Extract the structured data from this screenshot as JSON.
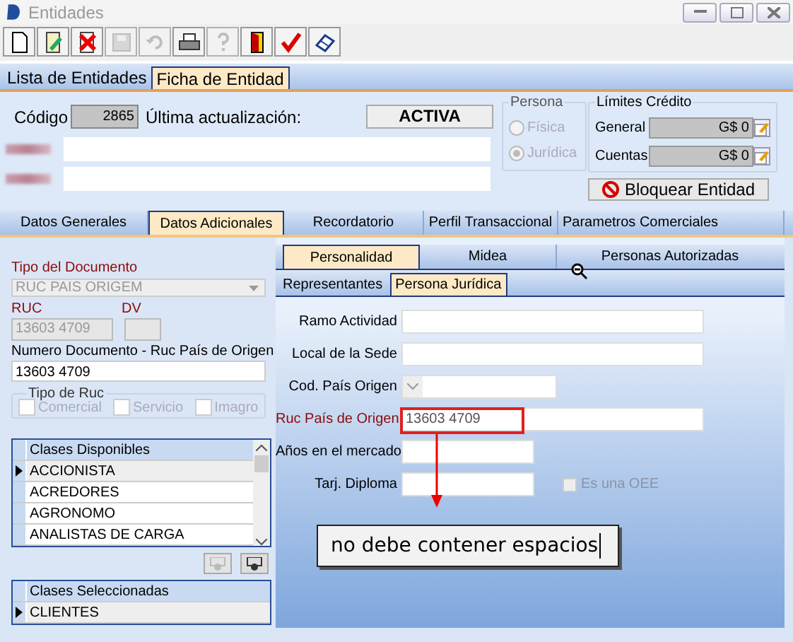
{
  "window": {
    "title": "Entidades"
  },
  "toolbar": [
    {
      "kind": "new",
      "disabled": false
    },
    {
      "kind": "edit",
      "disabled": false
    },
    {
      "kind": "delete",
      "disabled": false
    },
    {
      "kind": "save",
      "disabled": true
    },
    {
      "kind": "undo",
      "disabled": true
    },
    {
      "kind": "print",
      "disabled": false
    },
    {
      "kind": "help",
      "disabled": true
    },
    {
      "kind": "exit",
      "disabled": false
    },
    {
      "kind": "confirm",
      "disabled": false
    },
    {
      "kind": "eraser",
      "disabled": false
    }
  ],
  "main_tabs": [
    {
      "label": "Lista de Entidades",
      "selected": false
    },
    {
      "label": "Ficha de Entidad",
      "selected": true
    }
  ],
  "header": {
    "code_label": "Código",
    "code": "2865",
    "updated_label": "Última actualización:",
    "status": "ACTIVA",
    "persona": {
      "title": "Persona",
      "options": [
        {
          "label": "Física",
          "selected": false
        },
        {
          "label": "Jurídica",
          "selected": true
        }
      ]
    },
    "credit": {
      "title": "Límites Crédito",
      "rows": [
        {
          "label": "General",
          "value": "G$ 0"
        },
        {
          "label": "Cuentas",
          "value": "G$ 0"
        }
      ]
    },
    "block_button": "Bloquear Entidad"
  },
  "section_tabs": [
    {
      "label": "Datos Generales",
      "selected": false
    },
    {
      "label": "Datos Adicionales",
      "selected": true
    },
    {
      "label": "Recordatorio",
      "selected": false
    },
    {
      "label": "Perfil Transaccional",
      "selected": false
    },
    {
      "label": "Parametros Comerciales",
      "selected": false
    }
  ],
  "left": {
    "doc_type_label": "Tipo del Documento",
    "doc_type": "RUC PAIS ORIGEM",
    "ruc_label": "RUC",
    "ruc": "13603 4709",
    "dv_label": "DV",
    "number_label": "Numero Documento - Ruc País de Origen",
    "number": "13603 4709",
    "ruc_type": {
      "title": "Tipo de Ruc",
      "options": [
        {
          "label": "Comercial",
          "checked": false
        },
        {
          "label": "Servicio",
          "checked": false
        },
        {
          "label": "Imagro",
          "checked": false
        }
      ]
    },
    "available": {
      "header": "Clases Disponibles",
      "rows": [
        {
          "label": "ACCIONISTA",
          "selected": true
        },
        {
          "label": "ACREDORES",
          "selected": false
        },
        {
          "label": "AGRONOMO",
          "selected": false
        },
        {
          "label": "ANALISTAS DE CARGA",
          "selected": false
        }
      ]
    },
    "chosen": {
      "header": "Clases Seleccionadas",
      "rows": [
        {
          "label": "CLIENTES",
          "selected": true
        }
      ]
    }
  },
  "sub_tabs": [
    {
      "label": "Personalidad",
      "selected": true
    },
    {
      "label": "Midea",
      "selected": false
    },
    {
      "label": "Personas Autorizadas",
      "selected": false
    }
  ],
  "inner_tabs": [
    {
      "label": "Representantes",
      "selected": false
    },
    {
      "label": "Persona Jurídica",
      "selected": true
    }
  ],
  "form": [
    {
      "label": "Ramo Actividad",
      "kind": "wide",
      "required": false
    },
    {
      "label": "Local de la Sede",
      "kind": "wide",
      "required": false
    },
    {
      "label": "Cod. País Origen",
      "kind": "combo",
      "required": false
    },
    {
      "label": "Ruc País de Origen",
      "kind": "wide",
      "required": true,
      "value": "13603 4709"
    },
    {
      "label": "Años en el mercado",
      "kind": "short",
      "required": false
    },
    {
      "label": "Tarj. Diploma",
      "kind": "short",
      "required": false,
      "checkbox": {
        "label": "Es una OEE",
        "checked": false
      }
    }
  ],
  "annotation": {
    "text": "no debe contener espacios"
  }
}
